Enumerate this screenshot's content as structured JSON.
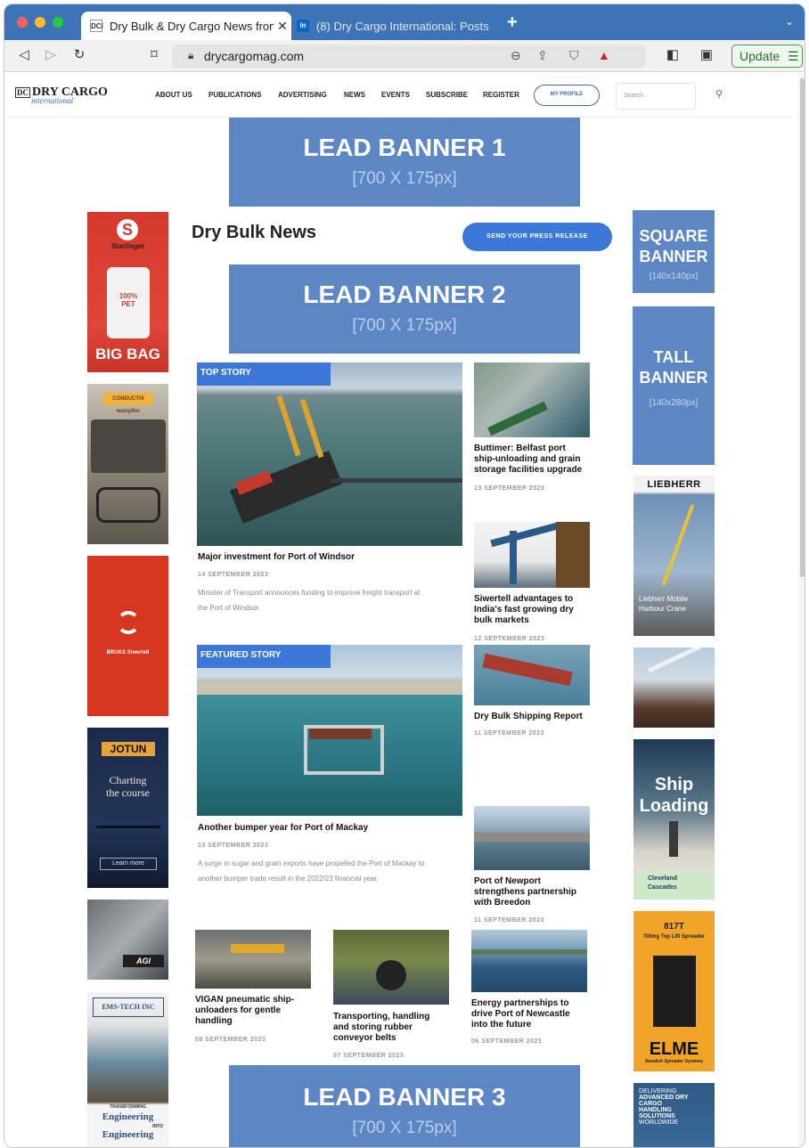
{
  "browser": {
    "tabs": [
      {
        "title": "Dry Bulk & Dry Cargo News from",
        "favicon": "DCI"
      },
      {
        "title": "(8) Dry Cargo International: Posts |",
        "favicon": "in"
      }
    ],
    "url": "drycargomag.com",
    "update_label": "Update"
  },
  "site": {
    "logo_main": "DRY CARGO",
    "logo_sub": "international",
    "logo_mark": "DC",
    "nav": [
      "ABOUT US",
      "PUBLICATIONS",
      "ADVERTISING",
      "NEWS",
      "EVENTS",
      "SUBSCRIBE",
      "REGISTER"
    ],
    "profile_label": "MY PROFILE",
    "search_placeholder": "Search"
  },
  "banners": {
    "lead1": {
      "title": "LEAD BANNER 1",
      "size": "[700 X 175px]"
    },
    "lead2": {
      "title": "LEAD BANNER 2",
      "size": "[700 X 175px]"
    },
    "lead3": {
      "title": "LEAD BANNER 3",
      "size": "[700 X 175px]"
    },
    "square": {
      "title_1": "SQUARE",
      "title_2": "BANNER",
      "size": "[140x140px]"
    },
    "tall": {
      "title_1": "TALL",
      "title_2": "BANNER",
      "size": "[140x280px]"
    }
  },
  "section": {
    "title": "Dry Bulk News",
    "press_button": "SEND YOUR PRESS RELEASE"
  },
  "ads": {
    "starlinger": {
      "brand": "Starlinger",
      "pet": "100% PET",
      "caption": "BIG BAG"
    },
    "conductix": {
      "brand": "CONDUCTIX wampfler"
    },
    "bruks": {
      "brand": "BRUKS Siwertell"
    },
    "jotun": {
      "brand": "JOTUN",
      "slogan_1": "Charting",
      "slogan_2": "the course",
      "cta": "Learn more"
    },
    "agi": {
      "brand": "AGI"
    },
    "emstech": {
      "brand": "EMS-TECH INC",
      "tag_1": "TRANSFORMING",
      "tag_2": "Engineering",
      "tag_3": "INTO",
      "tag_4": "Engineering"
    },
    "liebherr": {
      "brand": "LIEBHERR",
      "caption_1": "Liebherr Mobile",
      "caption_2": "Harbour Crane"
    },
    "cleveland": {
      "title_1": "Ship",
      "title_2": "Loading",
      "brand_1": "Cleveland",
      "brand_2": "Cascades"
    },
    "elme": {
      "model": "817T",
      "desc": "Tilting Top Lift Spreader",
      "brand": "ELME",
      "sub": "Swedish Spreader Systems"
    },
    "delivering": {
      "l1": "DELIVERING",
      "l2": "ADVANCED DRY",
      "l3": "CARGO",
      "l4": "HANDLING",
      "l5": "SOLUTIONS",
      "l6": "WORLDWIDE"
    }
  },
  "articles": {
    "top_story": {
      "tag": "TOP STORY",
      "title": "Major investment for Port of Windsor",
      "date": "14 SEPTEMBER 2023",
      "excerpt_1": "Minister of Transport announces funding to improve freight transport at",
      "excerpt_2": "the Port of Windsor."
    },
    "featured_story": {
      "tag": "FEATURED STORY",
      "title": "Another bumper year for Port of Mackay",
      "date": "13 SEPTEMBER 2023",
      "excerpt_1": "A surge in sugar and grain exports have propelled the Port of Mackay to",
      "excerpt_2": "another bumper trade result in the 2022/23 financial year."
    },
    "side": [
      {
        "title_1": "Buttimer: Belfast port",
        "title_2": "ship-unloading and grain",
        "title_3": "storage facilities upgrade",
        "date": "13 SEPTEMBER 2023"
      },
      {
        "title_1": "Siwertell advantages to",
        "title_2": "India's fast growing dry",
        "title_3": "bulk markets",
        "date": "12 SEPTEMBER 2023"
      },
      {
        "title_1": "Dry Bulk Shipping Report",
        "date": "11 SEPTEMBER 2023"
      },
      {
        "title_1": "Port of Newport",
        "title_2": "strengthens partnership",
        "title_3": "with Breedon",
        "date": "11 SEPTEMBER 2023"
      }
    ],
    "bottom": [
      {
        "title_1": "VIGAN pneumatic ship-",
        "title_2": "unloaders for gentle",
        "title_3": "handling",
        "date": "08 SEPTEMBER 2023"
      },
      {
        "title_1": "Transporting, handling",
        "title_2": "and storing rubber",
        "title_3": "conveyor belts",
        "date": "07 SEPTEMBER 2023"
      },
      {
        "title_1": "Energy partnerships to",
        "title_2": "drive Port of Newcastle",
        "title_3": "into the future",
        "date": "06 SEPTEMBER 2023"
      }
    ]
  },
  "colors": {
    "tabbar": "#3e73b8",
    "banner": "#5d86c5",
    "accent": "#3c78d8"
  }
}
